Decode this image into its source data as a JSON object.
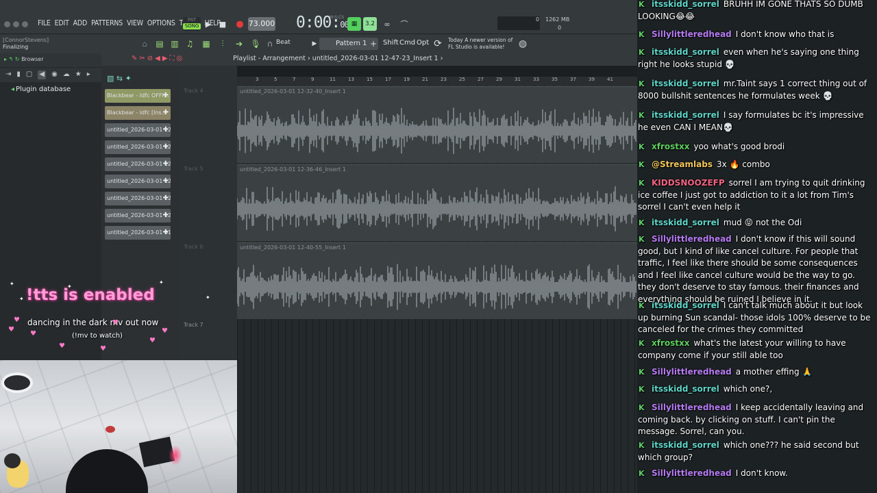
{
  "menu": [
    "FILE",
    "EDIT",
    "ADD",
    "PATTERNS",
    "VIEW",
    "OPTIONS",
    "TOOLS",
    "HELP"
  ],
  "pat_song": {
    "pat": "PAT",
    "song": "SONG"
  },
  "tempo": "73.000",
  "timer": {
    "main": "0:00:",
    "small": "00",
    "label": "M:S:CS"
  },
  "cpu": {
    "top_left": "0",
    "top_right": "1262 MB",
    "bottom": "0"
  },
  "hint": {
    "user": "[ConnorStevens]",
    "status": "Finalizing"
  },
  "toolbar": {
    "beat": "Beat",
    "pattern": "Pattern 1",
    "shift": "Shift",
    "cmd": "Cmd",
    "opt": "Opt"
  },
  "news": {
    "line1": "Today  A newer version of",
    "line2": "FL Studio is available!"
  },
  "browser": {
    "title": "Browser",
    "plugin_db": "Plugin database"
  },
  "channels": [
    {
      "label": "Blackbear - Idfc OFFI..."
    },
    {
      "label": "Blackbear - Idfc [Ins..."
    },
    {
      "label": "untitled_2026-03-01 12-..."
    },
    {
      "label": "untitled_2026-03-01 12-..."
    },
    {
      "label": "untitled_2026-03-01 12-..."
    },
    {
      "label": "untitled_2026-03-01 12-..."
    },
    {
      "label": "untitled_2026-03-01 12-..."
    },
    {
      "label": "untitled_2026-03-01 12-..."
    },
    {
      "label": "untitled_2026-03-01 01..."
    }
  ],
  "playlist": {
    "title": "Playlist - Arrangement",
    "file": "untitled_2026-03-01 12-47-23_Insert 1",
    "ruler": [
      "3",
      "5",
      "7",
      "9",
      "11",
      "13",
      "15",
      "17",
      "19",
      "21",
      "23",
      "25",
      "27",
      "29",
      "31",
      "33",
      "35",
      "37",
      "39",
      "41"
    ],
    "tracks": [
      {
        "label": "Track 4",
        "clip": "untitled_2026-03-01 12-32-40_Insert 1"
      },
      {
        "label": "Track 5",
        "clip": "untitled_2026-03-01 12-36-46_Insert 1"
      },
      {
        "label": "Track 6",
        "clip": "untitled_2026-03-01 12-40-55_Insert 1"
      },
      {
        "label": "Track 7",
        "clip": ""
      }
    ]
  },
  "overlay": {
    "tts": "!tts is enabled",
    "mv": "dancing in the dark mv out now",
    "mv_cmd": "(!mv to watch)"
  },
  "chat": [
    {
      "user": "itsskidd_sorrel",
      "text": "BRUHH IM GONE THATS SO DUMB LOOKING😂😂",
      "color": "itsk"
    },
    {
      "user": "Sillylittleredhead",
      "text": "I don't know who that is",
      "color": "silly"
    },
    {
      "user": "itsskidd_sorrel",
      "text": "even when he's saying one thing right he looks stupid 💀",
      "color": "itsk"
    },
    {
      "user": "itsskidd_sorrel",
      "text": "mr.Taint says 1 correct thing out of 8000 bullshit sentences he formulates week 💀",
      "color": "itsk"
    },
    {
      "user": "itsskidd_sorrel",
      "text": "I say formulates bc it's impressive he even CAN I MEAN💀",
      "color": "itsk"
    },
    {
      "user": "xfrostxx",
      "text": "yoo what's good brodi",
      "color": "frost"
    },
    {
      "user": "@Streamlabs",
      "text": "3x 🔥 combo",
      "color": "stream"
    },
    {
      "user": "KIDDSNOOZEFP",
      "text": "sorrel I am trying to quit drinking ice coffee I just got to addiction to it a lot from Tim's sorrel I can't even help it",
      "color": "kidd"
    },
    {
      "user": "itsskidd_sorrel",
      "text": "mud 😝 not the Odi",
      "color": "itsk"
    },
    {
      "user": "Sillylittleredhead",
      "text": "I don't know if this will sound good, but I kind of like cancel culture. For people that traffic, I feel like there should be some consequences and I feel like cancel culture would be the way to go. they don't deserve to stay famous. their finances and everything should be ruined I believe in it.",
      "color": "silly"
    },
    {
      "user": "itsskidd_sorrel",
      "text": "I can't talk much about it but look up burning Sun scandal- those idols 100% deserve to be canceled for the crimes they committed",
      "color": "itsk"
    },
    {
      "user": "xfrostxx",
      "text": "what's the latest your willing to have company come if your still able too",
      "color": "frost"
    },
    {
      "user": "Sillylittleredhead",
      "text": "a mother effing 🙏",
      "color": "silly"
    },
    {
      "user": "itsskidd_sorrel",
      "text": "which one?,",
      "color": "itsk"
    },
    {
      "user": "Sillylittleredhead",
      "text": "I keep accidentally leaving and coming back. by clicking on stuff. I can't pin the message. Sorrel, can you.",
      "color": "silly"
    },
    {
      "user": "itsskidd_sorrel",
      "text": "which one??? he said second but which group?",
      "color": "itsk"
    },
    {
      "user": "Sillylittleredhead",
      "text": "I don't know.",
      "color": "silly"
    }
  ],
  "badge_glyph": "K"
}
